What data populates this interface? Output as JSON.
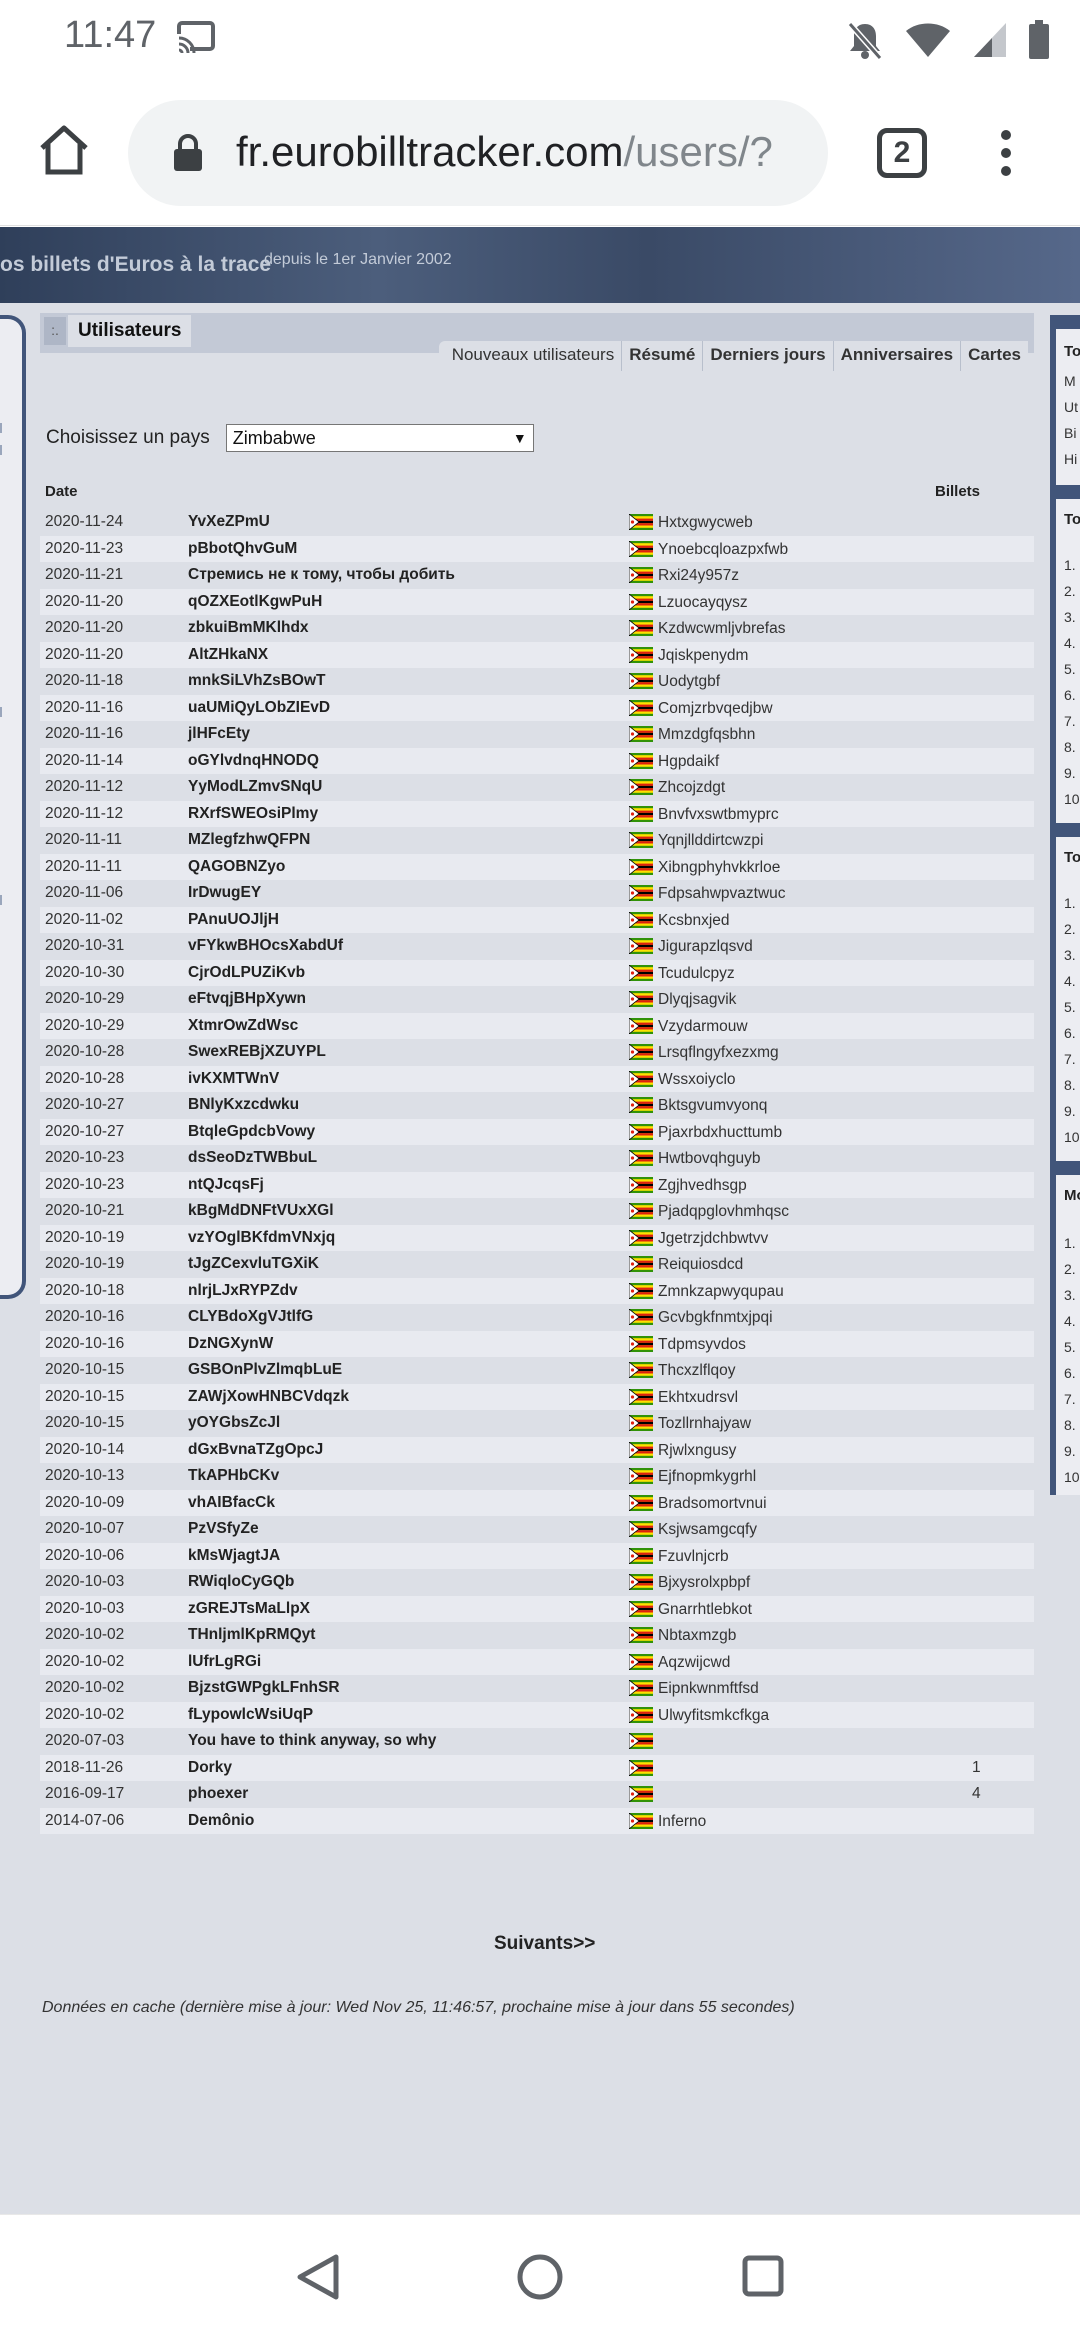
{
  "status_bar": {
    "time": "11:47"
  },
  "browser": {
    "url_domain": "fr.eurobilltracker.com",
    "url_path": "/users/?",
    "tab_count": "2"
  },
  "banner": {
    "title": "os billets d'Euros à la trace",
    "subtitle": "depuis le 1er Janvier 2002"
  },
  "tabs": {
    "active": "Utilisateurs",
    "marker": ":."
  },
  "subnav": [
    "Nouveaux utilisateurs",
    "Résumé",
    "Derniers jours",
    "Anniversaires",
    "Cartes"
  ],
  "country": {
    "label": "Choisissez un pays",
    "selected": "Zimbabwe"
  },
  "table": {
    "col_date": "Date",
    "col_billets": "Billets",
    "rows": [
      {
        "date": "2020-11-24",
        "user": "YvXeZPmU",
        "location": "Hxtxgwycweb",
        "billets": ""
      },
      {
        "date": "2020-11-23",
        "user": "pBbotQhvGuM",
        "location": "Ynoebcqloazpxfwb",
        "billets": ""
      },
      {
        "date": "2020-11-21",
        "user": "Стремись не к тому, чтобы добить",
        "location": "Rxi24y957z",
        "billets": ""
      },
      {
        "date": "2020-11-20",
        "user": "qOZXEotlKgwPuH",
        "location": "Lzuocayqysz",
        "billets": ""
      },
      {
        "date": "2020-11-20",
        "user": "zbkuiBmMKlhdx",
        "location": "Kzdwcwmljvbrefas",
        "billets": ""
      },
      {
        "date": "2020-11-20",
        "user": "AltZHkaNX",
        "location": "Jqiskpenydm",
        "billets": ""
      },
      {
        "date": "2020-11-18",
        "user": "mnkSiLVhZsBOwT",
        "location": "Uodytgbf",
        "billets": ""
      },
      {
        "date": "2020-11-16",
        "user": "uaUMiQyLObZIEvD",
        "location": "Comjzrbvqedjbw",
        "billets": ""
      },
      {
        "date": "2020-11-16",
        "user": "jlHFcEty",
        "location": "Mmzdgfqsbhn",
        "billets": ""
      },
      {
        "date": "2020-11-14",
        "user": "oGYlvdnqHNODQ",
        "location": "Hgpdaikf",
        "billets": ""
      },
      {
        "date": "2020-11-12",
        "user": "YyModLZmvSNqU",
        "location": "Zhcojzdgt",
        "billets": ""
      },
      {
        "date": "2020-11-12",
        "user": "RXrfSWEOsiPlmy",
        "location": "Bnvfvxswtbmyprc",
        "billets": ""
      },
      {
        "date": "2020-11-11",
        "user": "MZlegfzhwQFPN",
        "location": "Yqnjllddirtcwzpi",
        "billets": ""
      },
      {
        "date": "2020-11-11",
        "user": "QAGOBNZyo",
        "location": "Xibngphyhvkkrloe",
        "billets": ""
      },
      {
        "date": "2020-11-06",
        "user": "IrDwugEY",
        "location": "Fdpsahwpvaztwuc",
        "billets": ""
      },
      {
        "date": "2020-11-02",
        "user": "PAnuUOJljH",
        "location": "Kcsbnxjed",
        "billets": ""
      },
      {
        "date": "2020-10-31",
        "user": "vFYkwBHOcsXabdUf",
        "location": "Jigurapzlqsvd",
        "billets": ""
      },
      {
        "date": "2020-10-30",
        "user": "CjrOdLPUZiKvb",
        "location": "Tcudulcpyz",
        "billets": ""
      },
      {
        "date": "2020-10-29",
        "user": "eFtvqjBHpXywn",
        "location": "Dlyqjsagvik",
        "billets": ""
      },
      {
        "date": "2020-10-29",
        "user": "XtmrOwZdWsc",
        "location": "Vzydarmouw",
        "billets": ""
      },
      {
        "date": "2020-10-28",
        "user": "SwexREBjXZUYPL",
        "location": "Lrsqflngyfxezxmg",
        "billets": ""
      },
      {
        "date": "2020-10-28",
        "user": "ivKXMTWnV",
        "location": "Wssxoiyclo",
        "billets": ""
      },
      {
        "date": "2020-10-27",
        "user": "BNlyKxzcdwku",
        "location": "Bktsgvumvyonq",
        "billets": ""
      },
      {
        "date": "2020-10-27",
        "user": "BtqleGpdcbVowy",
        "location": "Pjaxrbdxhucttumb",
        "billets": ""
      },
      {
        "date": "2020-10-23",
        "user": "dsSeoDzTWBbuL",
        "location": "Hwtbovqhguyb",
        "billets": ""
      },
      {
        "date": "2020-10-23",
        "user": "ntQJcqsFj",
        "location": "Zgjhvedhsgp",
        "billets": ""
      },
      {
        "date": "2020-10-21",
        "user": "kBgMdDNFtVUxXGl",
        "location": "Pjadqpglovhmhqsc",
        "billets": ""
      },
      {
        "date": "2020-10-19",
        "user": "vzYOglBKfdmVNxjq",
        "location": "Jgetrzjdchbwtvv",
        "billets": ""
      },
      {
        "date": "2020-10-19",
        "user": "tJgZCexvluTGXiK",
        "location": "Reiquiosdcd",
        "billets": ""
      },
      {
        "date": "2020-10-18",
        "user": "nlrjLJxRYPZdv",
        "location": "Zmnkzapwyqupau",
        "billets": ""
      },
      {
        "date": "2020-10-16",
        "user": "CLYBdoXgVJtlfG",
        "location": "Gcvbgkfnmtxjpqi",
        "billets": ""
      },
      {
        "date": "2020-10-16",
        "user": "DzNGXynW",
        "location": "Tdpmsyvdos",
        "billets": ""
      },
      {
        "date": "2020-10-15",
        "user": "GSBOnPlvZlmqbLuE",
        "location": "Thcxzlflqoy",
        "billets": ""
      },
      {
        "date": "2020-10-15",
        "user": "ZAWjXowHNBCVdqzk",
        "location": "Ekhtxudrsvl",
        "billets": ""
      },
      {
        "date": "2020-10-15",
        "user": "yOYGbsZcJl",
        "location": "Tozllrnhajyaw",
        "billets": ""
      },
      {
        "date": "2020-10-14",
        "user": "dGxBvnaTZgOpcJ",
        "location": "Rjwlxngusy",
        "billets": ""
      },
      {
        "date": "2020-10-13",
        "user": "TkAPHbCKv",
        "location": "Ejfnopmkygrhl",
        "billets": ""
      },
      {
        "date": "2020-10-09",
        "user": "vhAIBfacCk",
        "location": "Bradsomortvnui",
        "billets": ""
      },
      {
        "date": "2020-10-07",
        "user": "PzVSfyZe",
        "location": "Ksjwsamgcqfy",
        "billets": ""
      },
      {
        "date": "2020-10-06",
        "user": "kMsWjagtJA",
        "location": "Fzuvlnjcrb",
        "billets": ""
      },
      {
        "date": "2020-10-03",
        "user": "RWiqloCyGQb",
        "location": "Bjxysrolxpbpf",
        "billets": ""
      },
      {
        "date": "2020-10-03",
        "user": "zGREJTsMaLlpX",
        "location": "Gnarrhtlebkot",
        "billets": ""
      },
      {
        "date": "2020-10-02",
        "user": "THnljmlKpRMQyt",
        "location": "Nbtaxmzgb",
        "billets": ""
      },
      {
        "date": "2020-10-02",
        "user": "lUfrLgRGi",
        "location": "Aqzwijcwd",
        "billets": ""
      },
      {
        "date": "2020-10-02",
        "user": "BjzstGWPgkLFnhSR",
        "location": "Eipnkwnmftfsd",
        "billets": ""
      },
      {
        "date": "2020-10-02",
        "user": "fLypowlcWsiUqP",
        "location": "Ulwyfitsmkcfkga",
        "billets": ""
      },
      {
        "date": "2020-07-03",
        "user": "You have to think anyway, so why",
        "location": "",
        "billets": ""
      },
      {
        "date": "2018-11-26",
        "user": "Dorky",
        "location": "",
        "billets": "1"
      },
      {
        "date": "2016-09-17",
        "user": "phoexer",
        "location": "",
        "billets": "4"
      },
      {
        "date": "2014-07-06",
        "user": "Demônio",
        "location": "Inferno",
        "billets": ""
      }
    ]
  },
  "next_link": "Suivants>>",
  "cache_note": "Données en cache (dernière mise à jour: Wed Nov 25, 11:46:57, prochaine mise à jour dans 55 secondes)",
  "right_panel": {
    "heads": [
      "To",
      "To au",
      "To de",
      "Mo te"
    ],
    "side_letters": [
      "M",
      "Ut",
      "Bi",
      "Hi"
    ],
    "list_numbers": [
      "1.",
      "2.",
      "3.",
      "4.",
      "5.",
      "6.",
      "7.",
      "8.",
      "9.",
      "10"
    ]
  },
  "colors": {
    "accent": "#41557a",
    "row_alt": "#e8eaf0",
    "page_bg": "#dcdfe6"
  }
}
